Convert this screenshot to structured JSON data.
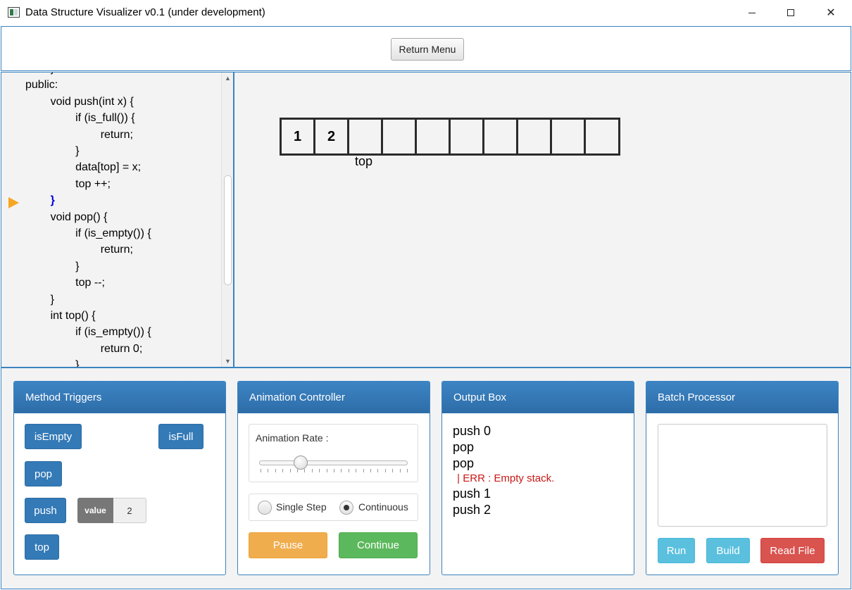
{
  "window": {
    "title": "Data Structure Visualizer v0.1 (under development)",
    "close_glyph": "✕"
  },
  "toolbar": {
    "return_label": "Return Menu"
  },
  "code": {
    "lines": [
      "        }",
      "public:",
      "        void push(int x) {",
      "                if (is_full()) {",
      "                        return;",
      "                }",
      "                data[top] = x;",
      "                top ++;",
      "        }",
      "        void pop() {",
      "                if (is_empty()) {",
      "                        return;",
      "                }",
      "                top --;",
      "        }",
      "        int top() {",
      "                if (is_empty()) {",
      "                        return 0;",
      "                }"
    ],
    "highlighted_line": 8
  },
  "stack": {
    "cells": [
      "1",
      "2",
      "",
      "",
      "",
      "",
      "",
      "",
      "",
      ""
    ],
    "top_label": "top",
    "top_index": 2
  },
  "method_triggers": {
    "title": "Method Triggers",
    "is_empty": "isEmpty",
    "is_full": "isFull",
    "pop": "pop",
    "push": "push",
    "top": "top",
    "value_label": "value",
    "value": "2"
  },
  "animation": {
    "title": "Animation Controller",
    "rate_label": "Animation Rate :",
    "rate_fraction": 0.28,
    "single_step": "Single Step",
    "continuous": "Continuous",
    "selected_mode": "Continuous",
    "pause": "Pause",
    "continue": "Continue"
  },
  "output": {
    "title": "Output Box",
    "lines": [
      {
        "text": "push 0",
        "type": "normal"
      },
      {
        "text": "pop",
        "type": "normal"
      },
      {
        "text": "pop",
        "type": "normal"
      },
      {
        "text": " | ERR : Empty stack.",
        "type": "err"
      },
      {
        "text": "push 1",
        "type": "normal"
      },
      {
        "text": "push 2",
        "type": "normal"
      }
    ]
  },
  "batch": {
    "title": "Batch Processor",
    "text": "",
    "run": "Run",
    "build": "Build",
    "read_file": "Read File"
  },
  "colors": {
    "accent": "#337ab7",
    "panel_border": "#3a83c0",
    "arrow": "#f6a623",
    "error": "#c91818"
  }
}
